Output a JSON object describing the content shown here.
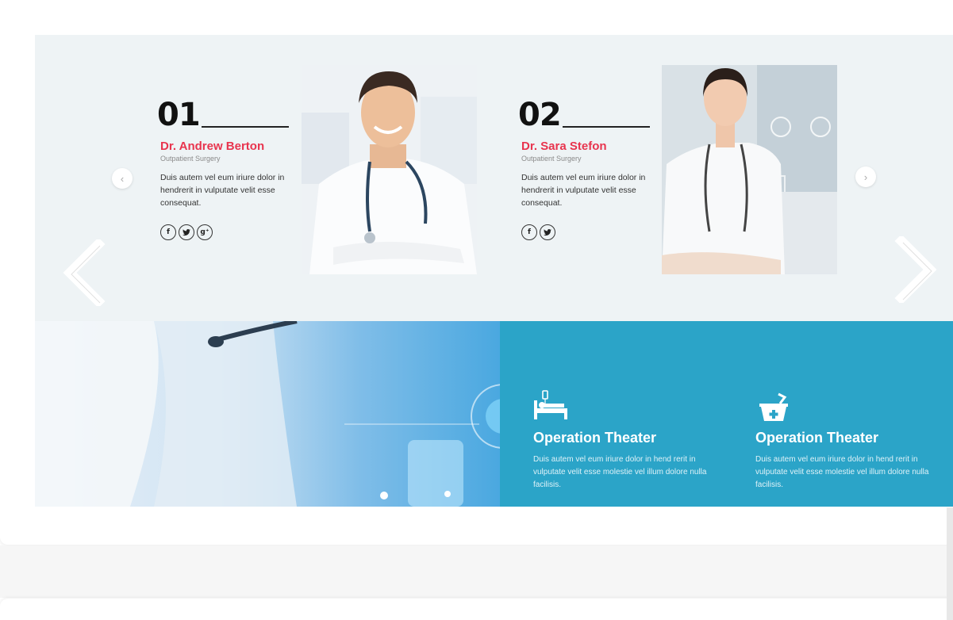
{
  "team": {
    "members": [
      {
        "number": "01",
        "name": "Dr. Andrew Berton",
        "role": "Outpatient Surgery",
        "description": "Duis autem vel eum iriure dolor in hendrerit in vulputate velit esse consequat.",
        "socials": [
          "facebook-icon",
          "twitter-icon",
          "google-plus-icon"
        ]
      },
      {
        "number": "02",
        "name": "Dr. Sara Stefon",
        "role": "Outpatient Surgery",
        "description": "Duis autem vel eum iriure dolor in hendrerit in vulputate velit esse consequat.",
        "socials": [
          "facebook-icon",
          "twitter-icon"
        ]
      }
    ],
    "nav": {
      "prev_icon": "chevron-left-icon",
      "next_icon": "chevron-right-icon"
    }
  },
  "services": {
    "items": [
      {
        "icon": "hospital-bed-icon",
        "title": "Operation Theater",
        "description": "Duis autem vel eum iriure dolor in hend rerit in vulputate velit esse molestie vel illum dolore nulla facilisis."
      },
      {
        "icon": "first-aid-kit-icon",
        "title": "Operation Theater",
        "description": "Duis autem vel eum iriure dolor in hend rerit in vulputate velit esse molestie vel illum dolore nulla facilisis."
      }
    ]
  },
  "colors": {
    "accent": "#e8344e",
    "panel_bg": "#eef3f5",
    "services_blue": "#2ba4c8"
  }
}
